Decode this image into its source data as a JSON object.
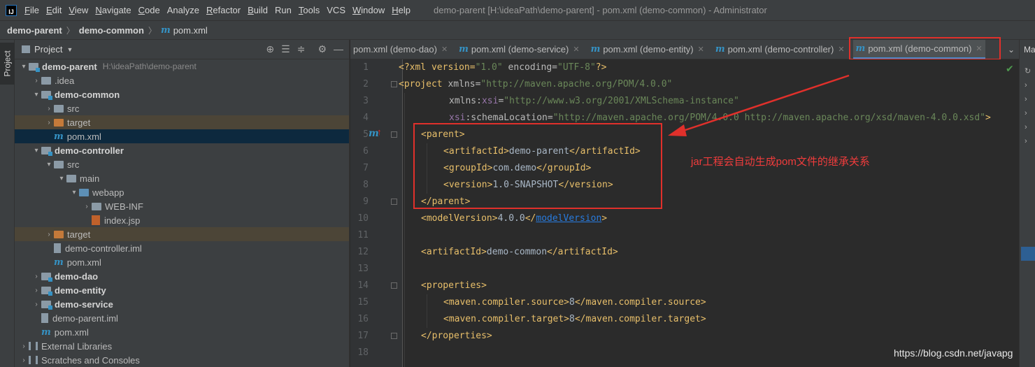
{
  "menubar": {
    "items": [
      {
        "mn": "F",
        "rest": "ile"
      },
      {
        "mn": "E",
        "rest": "dit"
      },
      {
        "mn": "V",
        "rest": "iew"
      },
      {
        "mn": "N",
        "rest": "avigate"
      },
      {
        "mn": "C",
        "rest": "ode"
      },
      {
        "mn": "",
        "rest": "Analyze"
      },
      {
        "mn": "R",
        "rest": "efactor"
      },
      {
        "mn": "B",
        "rest": "uild"
      },
      {
        "mn": "",
        "rest": "Run"
      },
      {
        "mn": "T",
        "rest": "ools"
      },
      {
        "mn": "",
        "rest": "VCS"
      },
      {
        "mn": "W",
        "rest": "indow"
      },
      {
        "mn": "H",
        "rest": "elp"
      }
    ],
    "window_title": "demo-parent [H:\\ideaPath\\demo-parent] - pom.xml (demo-common) - Administrator"
  },
  "breadcrumbs": {
    "items": [
      "demo-parent",
      "demo-common",
      "pom.xml"
    ]
  },
  "left_stripe": {
    "tab_label": "Project"
  },
  "project_panel": {
    "title": "Project",
    "tree": [
      {
        "label": "demo-parent",
        "hint": "H:\\ideaPath\\demo-parent",
        "bold": true
      },
      {
        "label": ".idea"
      },
      {
        "label": "demo-common",
        "bold": true
      },
      {
        "label": "src"
      },
      {
        "label": "target"
      },
      {
        "label": "pom.xml"
      },
      {
        "label": "demo-controller",
        "bold": true
      },
      {
        "label": "src"
      },
      {
        "label": "main"
      },
      {
        "label": "webapp"
      },
      {
        "label": "WEB-INF"
      },
      {
        "label": "index.jsp"
      },
      {
        "label": "target"
      },
      {
        "label": "demo-controller.iml"
      },
      {
        "label": "pom.xml"
      },
      {
        "label": "demo-dao",
        "bold": true
      },
      {
        "label": "demo-entity",
        "bold": true
      },
      {
        "label": "demo-service",
        "bold": true
      },
      {
        "label": "demo-parent.iml"
      },
      {
        "label": "pom.xml"
      },
      {
        "label": "External Libraries"
      },
      {
        "label": "Scratches and Consoles"
      }
    ]
  },
  "editor_tabs": [
    {
      "label": "pom.xml (demo-dao)",
      "active": false
    },
    {
      "label": "pom.xml (demo-service)",
      "active": false
    },
    {
      "label": "pom.xml (demo-entity)",
      "active": false
    },
    {
      "label": "pom.xml (demo-controller)",
      "active": false
    },
    {
      "label": "pom.xml (demo-common)",
      "active": true
    }
  ],
  "right_stripe": {
    "label": "Ma"
  },
  "editor": {
    "line_numbers": [
      "1",
      "2",
      "3",
      "4",
      "5",
      "6",
      "7",
      "8",
      "9",
      "10",
      "11",
      "12",
      "13",
      "14",
      "15",
      "16",
      "17",
      "18"
    ],
    "gutter_marker": "m",
    "code": {
      "l1": {
        "a": "<?xml version=",
        "b": "\"1.0\"",
        "c": " encoding=",
        "d": "\"UTF-8\"",
        "e": "?>"
      },
      "l2": {
        "a": "<project ",
        "b": "xmlns=",
        "c": "\"http://maven.apache.org/POM/4.0.0\""
      },
      "l3": {
        "a": "xmlns:",
        "b": "xsi",
        "c": "=",
        "d": "\"http://www.w3.org/2001/XMLSchema-instance\""
      },
      "l4": {
        "a": "xsi",
        "b": ":schemaLocation=",
        "c": "\"http://maven.apache.org/POM/4.0.0 http://maven.apache.org/xsd/maven-4.0.0.xsd\"",
        "d": ">"
      },
      "l5": "<parent>",
      "l6": {
        "open": "<artifactId>",
        "val": "demo-parent",
        "close": "</artifactId>"
      },
      "l7": {
        "open": "<groupId>",
        "val": "com.demo",
        "close": "</groupId>"
      },
      "l8": {
        "open": "<version>",
        "val": "1.0-SNAPSHOT",
        "close": "</version>"
      },
      "l9": "</parent>",
      "l10": {
        "open": "<modelVersion>",
        "val": "4.0.0",
        "close_a": "</",
        "close_link": "modelVersion",
        "close_b": ">"
      },
      "l12": {
        "open": "<artifactId>",
        "val": "demo-common",
        "close": "</artifactId>"
      },
      "l14": "<properties>",
      "l15": {
        "open": "<maven.compiler.source>",
        "val": "8",
        "close": "</maven.compiler.source>"
      },
      "l16": {
        "open": "<maven.compiler.target>",
        "val": "8",
        "close": "</maven.compiler.target>"
      },
      "l17": "</properties>"
    }
  },
  "annotation": {
    "text": "jar工程会自动生成pom文件的继承关系",
    "color": "#f03c3c"
  },
  "watermark": "https://blog.csdn.net/javapg",
  "colors": {
    "accent": "#4a88c7",
    "tag": "#e8bf6a",
    "string": "#6a8759",
    "highlight_box": "#e0302b"
  },
  "icons": [
    "app-logo-icon",
    "folder-icon",
    "module-folder-icon",
    "maven-m-icon",
    "jsp-icon",
    "iml-icon",
    "library-icon",
    "crosshair-icon",
    "expand-all-icon",
    "collapse-all-icon",
    "gear-icon",
    "minimize-icon",
    "close-icon",
    "chevron-down-icon",
    "check-icon"
  ]
}
